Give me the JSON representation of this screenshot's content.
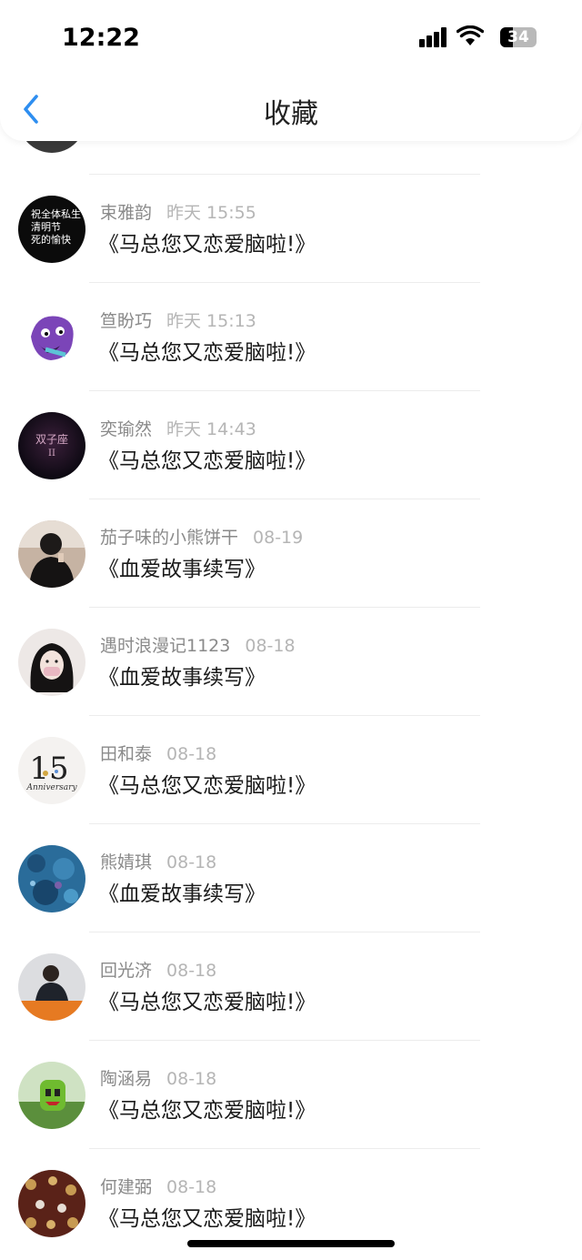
{
  "status_bar": {
    "time": "12:22",
    "battery": "34",
    "battery_fraction": 0.34,
    "icons": [
      "signal-icon",
      "wifi-icon",
      "battery-icon"
    ]
  },
  "nav": {
    "title": "收藏",
    "back_icon": "chevron-left-icon",
    "accent_color": "#2e8ef0"
  },
  "items": [
    {
      "name": "束雅韵",
      "date": "昨天 15:55",
      "content": "《马总您又恋爱脑啦!》",
      "avatar": {
        "bg": "#0b0b0b",
        "caption": "祝全体私生\n清明节\n死的愉快"
      }
    },
    {
      "name": "笪盼巧",
      "date": "昨天 15:13",
      "content": "《马总您又恋爱脑啦!》",
      "avatar": {
        "bg": "#ffffff",
        "kind": "purple-monster"
      }
    },
    {
      "name": "奕瑜然",
      "date": "昨天 14:43",
      "content": "《马总您又恋爱脑啦!》",
      "avatar": {
        "bg": "#0c0a16",
        "caption": "双子座\nII"
      }
    },
    {
      "name": "茄子味的小熊饼干",
      "date": "08-19",
      "content": "《血爱故事续写》",
      "avatar": {
        "bg": "#b09a88",
        "kind": "person-dark"
      }
    },
    {
      "name": "遇时浪漫记1123",
      "date": "08-18",
      "content": "《血爱故事续写》",
      "avatar": {
        "bg": "#e9e3e1",
        "kind": "girl"
      }
    },
    {
      "name": "田和泰",
      "date": "08-18",
      "content": "《马总您又恋爱脑啦!》",
      "avatar": {
        "bg": "#f2f0ee",
        "caption": "15\nAnniversary"
      }
    },
    {
      "name": "熊婧琪",
      "date": "08-18",
      "content": "《血爱故事续写》",
      "avatar": {
        "bg": "#2a6c9a",
        "kind": "blue-texture"
      }
    },
    {
      "name": "回光济",
      "date": "08-18",
      "content": "《马总您又恋爱脑啦!》",
      "avatar": {
        "bg": "#dcdde0",
        "kind": "person-orange-banner"
      }
    },
    {
      "name": "陶涵易",
      "date": "08-18",
      "content": "《马总您又恋爱脑啦!》",
      "avatar": {
        "bg": "#6aa347",
        "kind": "green-doll"
      }
    },
    {
      "name": "何建弼",
      "date": "08-18",
      "content": "《马总您又恋爱脑啦!》",
      "avatar": {
        "bg": "#5a2218",
        "kind": "leopard-pattern"
      }
    }
  ]
}
